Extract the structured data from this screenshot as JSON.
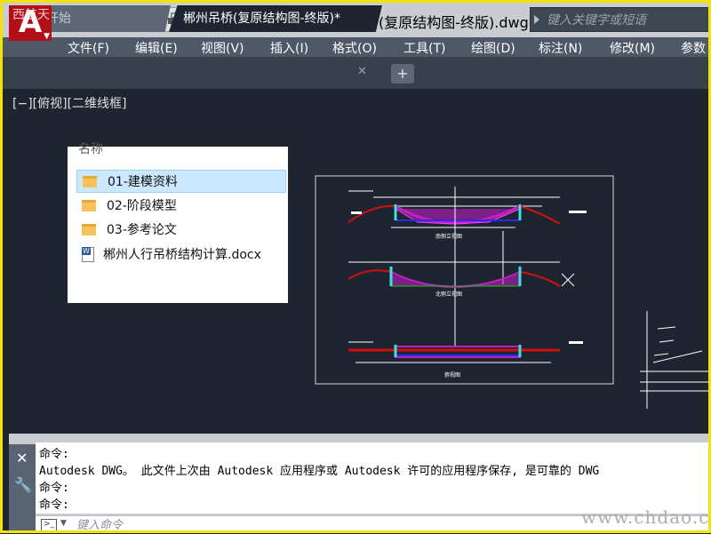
{
  "app": {
    "watermark_top": "西航天",
    "doc_title": "郴州吊桥(复原结构图-终版).dwg",
    "search_placeholder": "键入关键字或短语",
    "watermark_bottom": "www.chdao.com",
    "accent_color": "#b40f18"
  },
  "quick_access": {
    "icons": [
      "new-file-icon",
      "open-folder-icon",
      "save-icon",
      "save-as-icon",
      "print-icon",
      "undo-icon",
      "dropdown-icon",
      "more-icon"
    ]
  },
  "menu": {
    "items": [
      "文件(F)",
      "编辑(E)",
      "视图(V)",
      "插入(I)",
      "格式(O)",
      "工具(T)",
      "绘图(D)",
      "标注(N)",
      "修改(M)",
      "参数"
    ]
  },
  "tabs": {
    "start": "开始",
    "active": "郴州吊桥(复原结构图-终版)*"
  },
  "viewport": {
    "label": "[−][俯视][二维线框]"
  },
  "explorer": {
    "header": "名称",
    "items": [
      {
        "name": "01-建模资料",
        "type": "folder"
      },
      {
        "name": "02-阶段模型",
        "type": "folder"
      },
      {
        "name": "03-参考论文",
        "type": "folder"
      },
      {
        "name": "郴州人行吊桥结构计算.docx",
        "type": "docx"
      }
    ]
  },
  "drawing": {
    "labels": [
      "南侧立视图",
      "北侧立视图",
      "俯视图"
    ]
  },
  "command": {
    "history": [
      "命令:",
      "Autodesk DWG。  此文件上次由 Autodesk 应用程序或 Autodesk 许可的应用程序保存, 是可靠的 DWG",
      "命令:",
      "命令:"
    ],
    "input_placeholder": "键入命令"
  }
}
